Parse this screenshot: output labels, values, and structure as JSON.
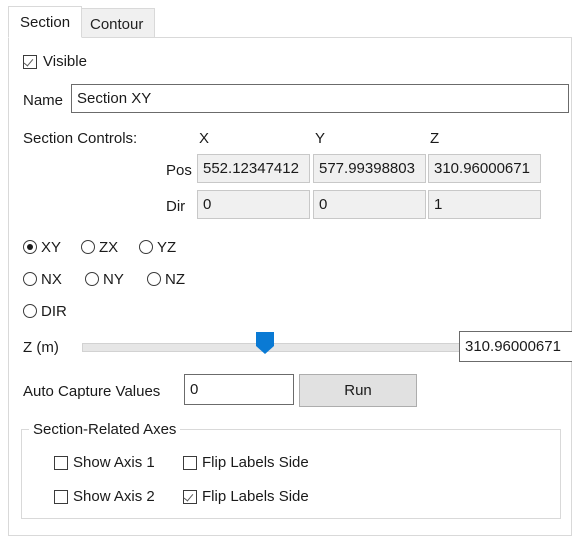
{
  "tabs": [
    {
      "label": "Section",
      "active": true
    },
    {
      "label": "Contour",
      "active": false
    }
  ],
  "visible": {
    "label": "Visible",
    "checked": true
  },
  "name": {
    "label": "Name",
    "value": "Section XY"
  },
  "section_controls": {
    "label": "Section Controls:",
    "columns": [
      "X",
      "Y",
      "Z"
    ],
    "rows": [
      {
        "label": "Pos",
        "values": [
          "552.12347412",
          "577.99398803",
          "310.96000671"
        ]
      },
      {
        "label": "Dir",
        "values": [
          "0",
          "0",
          "1"
        ]
      }
    ]
  },
  "orientation": {
    "options": [
      "XY",
      "ZX",
      "YZ",
      "NX",
      "NY",
      "NZ",
      "DIR"
    ],
    "selected": "XY"
  },
  "slider": {
    "label": "Z (m)",
    "value": "310.96000671",
    "fraction": 0.46
  },
  "auto_capture": {
    "label": "Auto Capture Values",
    "value": "0",
    "run_label": "Run"
  },
  "axes_group": {
    "title": "Section-Related Axes",
    "rows": [
      {
        "show_label": "Show Axis 1",
        "show_checked": false,
        "flip_label": "Flip Labels Side",
        "flip_checked": false
      },
      {
        "show_label": "Show Axis 2",
        "show_checked": false,
        "flip_label": "Flip Labels Side",
        "flip_checked": true
      }
    ]
  },
  "colors": {
    "accent": "#0a7ad4",
    "panel_border": "#d9d9d9",
    "field_disabled": "#f0f0f0",
    "button_face": "#e1e1e1"
  }
}
